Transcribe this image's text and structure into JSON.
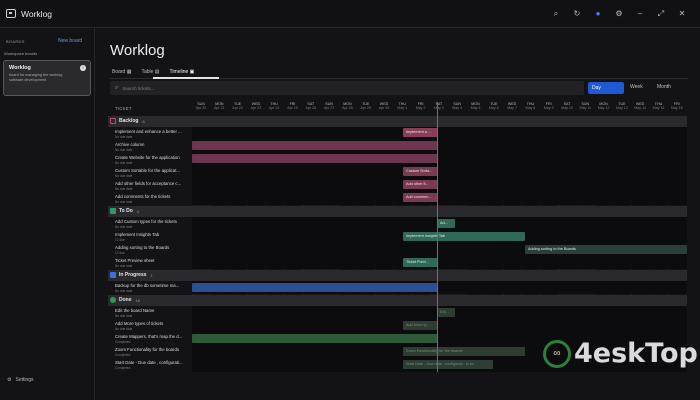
{
  "app": {
    "title": "Worklog"
  },
  "titlebar": {
    "icons": [
      "search-icon",
      "refresh-icon",
      "record-icon",
      "gear-icon",
      "minimize-icon",
      "maximize-icon",
      "close-icon"
    ]
  },
  "sidebar": {
    "boards_label": "BOARDS",
    "new_board": "New board",
    "workspace_label": "Workspace boards",
    "card_title": "Worklog",
    "card_desc": "board for managing the worklog software development",
    "settings": "Settings"
  },
  "main": {
    "title": "Worklog",
    "views": {
      "board": "Board",
      "table": "Table",
      "timeline": "Timeline"
    },
    "search_placeholder": "Search tickets...",
    "scale": {
      "day": "Day",
      "week": "Week",
      "month": "Month"
    },
    "ticket_header": "TICKET"
  },
  "columns": [
    {
      "d": "SUN",
      "t": "Apr 20"
    },
    {
      "d": "MON",
      "t": "Apr 21"
    },
    {
      "d": "TUE",
      "t": "Apr 22"
    },
    {
      "d": "WED",
      "t": "Apr 23"
    },
    {
      "d": "THU",
      "t": "Apr 24"
    },
    {
      "d": "FRI",
      "t": "Apr 25"
    },
    {
      "d": "SAT",
      "t": "Apr 26"
    },
    {
      "d": "SUN",
      "t": "Apr 27"
    },
    {
      "d": "MON",
      "t": "Apr 28"
    },
    {
      "d": "TUE",
      "t": "Apr 29"
    },
    {
      "d": "WED",
      "t": "Apr 30"
    },
    {
      "d": "THU",
      "t": "May 1"
    },
    {
      "d": "FRI",
      "t": "May 2"
    },
    {
      "d": "SAT",
      "t": "May 3"
    },
    {
      "d": "SUN",
      "t": "May 4"
    },
    {
      "d": "MON",
      "t": "May 5"
    },
    {
      "d": "TUE",
      "t": "May 6"
    },
    {
      "d": "WED",
      "t": "May 7"
    },
    {
      "d": "THU",
      "t": "May 8"
    },
    {
      "d": "FRI",
      "t": "May 9"
    },
    {
      "d": "SAT",
      "t": "May 10"
    },
    {
      "d": "SUN",
      "t": "May 11"
    },
    {
      "d": "MON",
      "t": "May 12"
    },
    {
      "d": "TUE",
      "t": "May 13"
    },
    {
      "d": "WED",
      "t": "May 14"
    },
    {
      "d": "THU",
      "t": "May 15"
    },
    {
      "d": "FRI",
      "t": "May 16"
    }
  ],
  "groups": {
    "backlog": {
      "name": "Backlog",
      "count": "6",
      "color": "#c2476f"
    },
    "todo": {
      "name": "To Do",
      "count": "4",
      "color": "#2f9a6b"
    },
    "inprogress": {
      "name": "In Progress",
      "count": "1",
      "color": "#3d6fe0"
    },
    "done": {
      "name": "Done",
      "count": "16",
      "color": "#2e9a4e"
    }
  },
  "tasks": {
    "b1": {
      "name": "Implement and enhance a better ...",
      "sub": "No due date"
    },
    "b2": {
      "name": "Archive column",
      "sub": "No due date"
    },
    "b3": {
      "name": "Create Website for the application",
      "sub": "No due date"
    },
    "b4": {
      "name": "Custom Sortable for the applicat...",
      "sub": "No due date"
    },
    "b5": {
      "name": "Add other fields for acceptance c...",
      "sub": "No due date"
    },
    "b6": {
      "name": "Add comments for the tickets",
      "sub": "No due date"
    },
    "t1": {
      "name": "Add Custom types for the tickets",
      "sub": "No due date"
    },
    "t2": {
      "name": "Implement Insights Tab",
      "sub": "12 due"
    },
    "t3": {
      "name": "Adding sorting to the Boards",
      "sub": "12 due"
    },
    "t4": {
      "name": "Ticket Preview sheet",
      "sub": "No due date"
    },
    "p1": {
      "name": "Backup for the db sometime ma...",
      "sub": "No due date"
    },
    "d1": {
      "name": "Edit the board Name",
      "sub": "No due date"
    },
    "d2": {
      "name": "Add More types of tickets",
      "sub": "No due date"
    },
    "d3": {
      "name": "Create Mappers, that's map the d...",
      "sub": "Completed"
    },
    "d4": {
      "name": "Zoom Functionality for the boards",
      "sub": "Completed"
    },
    "d5": {
      "name": "Start Date - Due date , configurati...",
      "sub": "Completed"
    }
  },
  "bars": {
    "b1": "Implement a ...",
    "b4": "Custom Sorta...",
    "b5": "Add other fi...",
    "b6": "Add commen...",
    "t1": "Ad...",
    "t2": "Implement Insights Tab",
    "t3": "Adding sorting to the Boards",
    "t4": "Ticket Previ...",
    "d1": "Edi...",
    "d2": "Add More ty...",
    "d4": "Zoom Functionality for the boards",
    "d5": "Start Date - Due date , configurati...in ev..."
  },
  "watermark": {
    "text": "4eskTop"
  }
}
